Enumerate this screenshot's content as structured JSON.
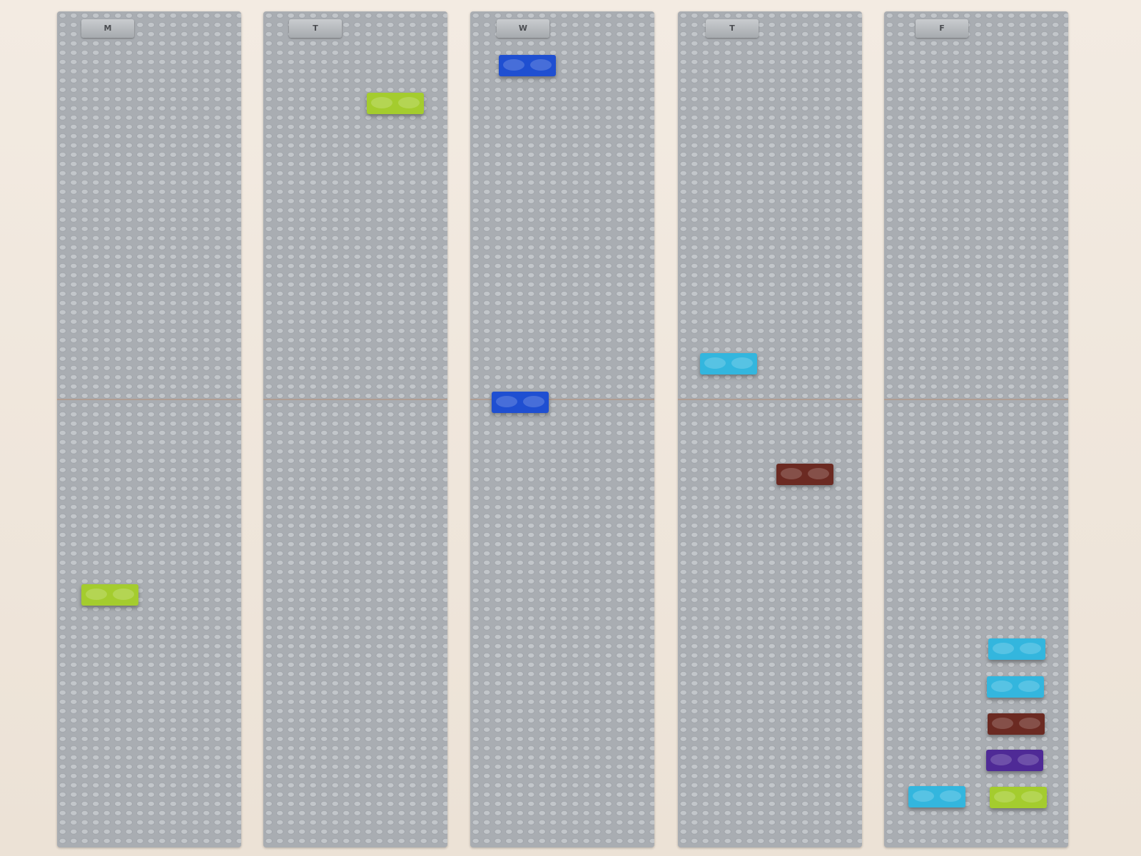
{
  "board": {
    "days": [
      {
        "id": "mon",
        "label": "M"
      },
      {
        "id": "tue",
        "label": "T"
      },
      {
        "id": "wed",
        "label": "W"
      },
      {
        "id": "thu",
        "label": "T"
      },
      {
        "id": "fri",
        "label": "F"
      }
    ]
  },
  "colors": {
    "lime": "#a4cc2e",
    "blue": "#1f4fd1",
    "cyan": "#33b6de",
    "brown": "#6b2a22",
    "purple": "#4f2a96"
  },
  "bricks": {
    "mon": [
      "lime"
    ],
    "tue": [
      "lime"
    ],
    "wed": [
      "blue",
      "blue"
    ],
    "thu": [
      "cyan",
      "brown"
    ],
    "fri": [
      "cyan",
      "cyan",
      "brown",
      "purple",
      "cyan",
      "lime"
    ]
  }
}
